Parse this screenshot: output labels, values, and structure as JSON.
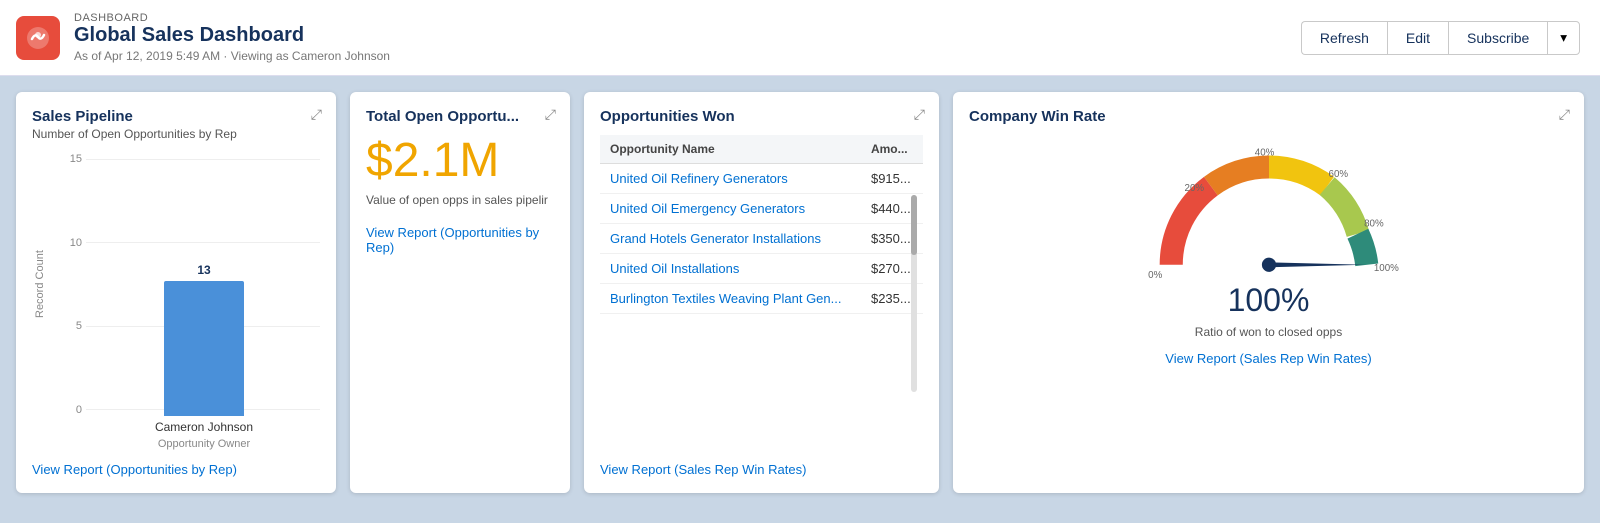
{
  "header": {
    "label": "DASHBOARD",
    "title": "Global Sales Dashboard",
    "subtitle": "As of Apr 12, 2019 5:49 AM · Viewing as Cameron Johnson",
    "logo_icon": "cloud-icon",
    "buttons": {
      "refresh": "Refresh",
      "edit": "Edit",
      "subscribe": "Subscribe"
    }
  },
  "pipeline": {
    "title": "Sales Pipeline",
    "subtitle": "Number of Open Opportunities by Rep",
    "y_labels": [
      "15",
      "10",
      "5",
      "0"
    ],
    "y_axis_title": "Record Count",
    "bar_value": "13",
    "bar_label": "Cameron Johnson",
    "x_axis_title": "Opportunity Owner",
    "link": "View Report (Opportunities by Rep)"
  },
  "total_open": {
    "title": "Total Open Opportu...",
    "amount": "$2.1M",
    "description": "Value of open opps in sales pipelir",
    "link": "View Report (Opportunities by Rep)"
  },
  "opportunities_won": {
    "title": "Opportunities Won",
    "col_name": "Opportunity Name",
    "col_amount": "Amo...",
    "rows": [
      {
        "name": "United Oil Refinery Generators",
        "amount": "$915..."
      },
      {
        "name": "United Oil Emergency Generators",
        "amount": "$440..."
      },
      {
        "name": "Grand Hotels Generator Installations",
        "amount": "$350..."
      },
      {
        "name": "United Oil Installations",
        "amount": "$270..."
      },
      {
        "name": "Burlington Textiles Weaving Plant Gen...",
        "amount": "$235..."
      }
    ],
    "link": "View Report (Sales Rep Win Rates)"
  },
  "win_rate": {
    "title": "Company Win Rate",
    "percentage": "100%",
    "labels": {
      "p0": "0%",
      "p20": "20%",
      "p40": "40%",
      "p60": "60%",
      "p80": "80%",
      "p100": "100%"
    },
    "description": "Ratio of won to closed opps",
    "link": "View Report (Sales Rep Win Rates)"
  }
}
